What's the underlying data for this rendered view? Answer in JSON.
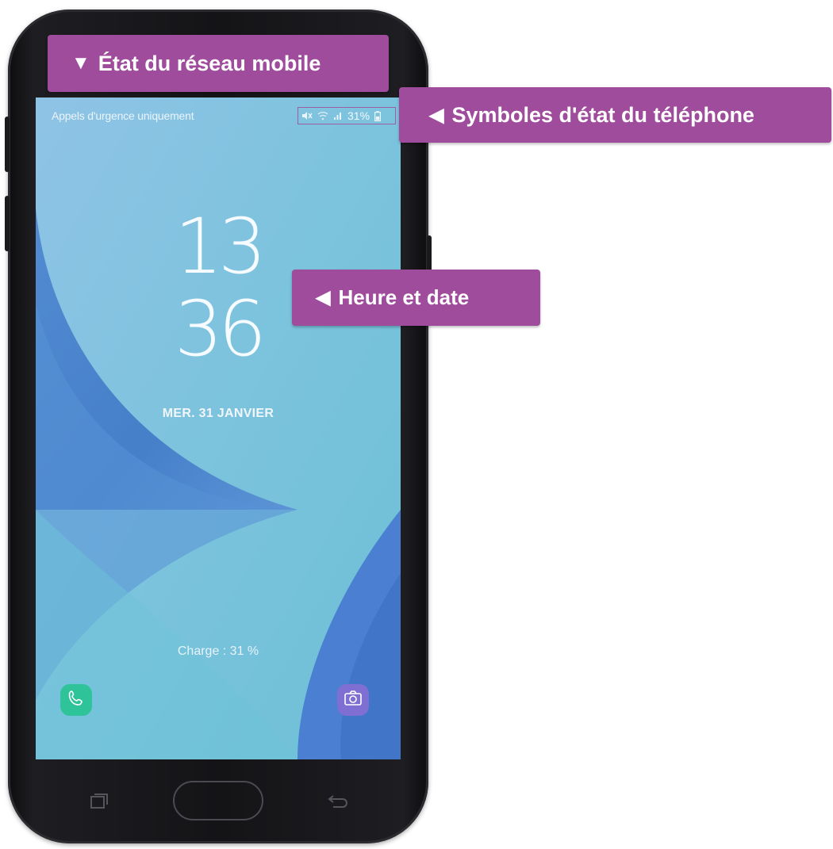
{
  "callouts": {
    "network": {
      "arrow": "▼",
      "label": "État du réseau mobile"
    },
    "status_symbols": {
      "arrow": "◀",
      "label": "Symboles d'état du téléphone"
    },
    "time_date": {
      "arrow": "◀",
      "label": "Heure et date"
    }
  },
  "lockscreen": {
    "status_bar": {
      "network_text": "Appels d'urgence uniquement",
      "battery_percent": "31%",
      "icons": [
        "mute-icon",
        "wifi-icon",
        "signal-icon",
        "battery-icon"
      ]
    },
    "clock": {
      "hours": "13",
      "minutes": "36"
    },
    "date": "MER. 31 JANVIER",
    "charge_text": "Charge : 31 %",
    "shortcuts": [
      "phone-icon",
      "camera-icon"
    ]
  },
  "nav_keys": [
    "recent-apps-icon",
    "home-button",
    "back-icon"
  ],
  "colors": {
    "callout": "#a04c9d",
    "phone_shortcut": "#2fc39a",
    "camera_shortcut": "#7f6fd3",
    "wallpaper_light": "#7cc0df",
    "wallpaper_dark": "#3f78c6"
  }
}
